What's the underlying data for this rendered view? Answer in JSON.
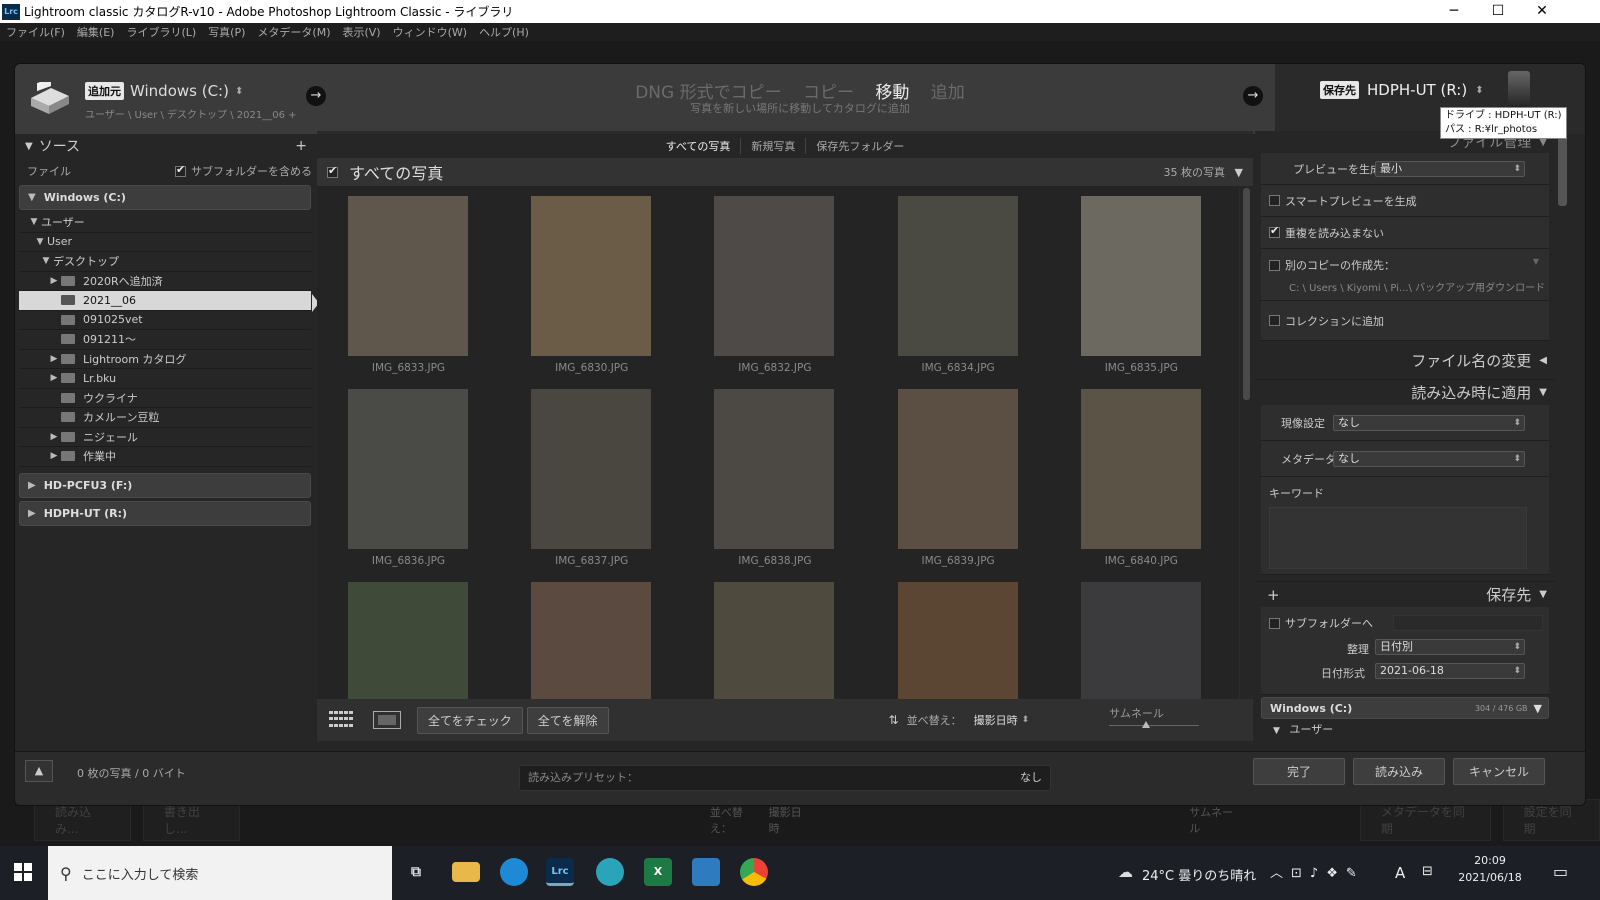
{
  "window": {
    "title": "Lightroom classic カタログR-v10 - Adobe Photoshop Lightroom Classic - ライブラリ",
    "app_icon": "Lrc",
    "minimize": "─",
    "maximize": "☐",
    "close": "✕"
  },
  "menu": [
    "ファイル(F)",
    "編集(E)",
    "ライブラリ(L)",
    "写真(P)",
    "メタデータ(M)",
    "表示(V)",
    "ウィンドウ(W)",
    "ヘルプ(H)"
  ],
  "background_bar": {
    "import": "読み込み...",
    "export": "書き出し...",
    "sort_label": "並べ替え：",
    "sort_value": "撮影日時",
    "thumb_label": "サムネール",
    "sync_meta": "メタデータを同期",
    "sync_settings": "設定を同期"
  },
  "import": {
    "source": {
      "badge": "追加元",
      "name": "Windows (C:)",
      "path": "ユーザー \\ User \\ デスクトップ \\ 2021__06 +"
    },
    "modes": [
      "DNG 形式でコピー",
      "コピー",
      "移動",
      "追加"
    ],
    "active_mode_index": 2,
    "mode_description": "写真を新しい場所に移動してカタログに追加",
    "destination": {
      "badge": "保存先",
      "name": "HDPH-UT (R:)"
    },
    "tooltip": {
      "line1": "ドライブ : HDPH-UT (R:)",
      "line2": "パス : R:¥lr_photos"
    },
    "left": {
      "header": "ソース",
      "add": "+",
      "file_label": "ファイル",
      "include_subfolders": "サブフォルダーを含める",
      "volumes": [
        {
          "name": "Windows (C:)",
          "expanded": true
        },
        {
          "name": "HD-PCFU3 (F:)",
          "expanded": false
        },
        {
          "name": "HDPH-UT (R:)",
          "expanded": false
        }
      ],
      "tree": [
        {
          "label": "ユーザー",
          "level": 1,
          "tri": "▼",
          "folder": false,
          "selected": false
        },
        {
          "label": "User",
          "level": 2,
          "tri": "▼",
          "folder": false,
          "selected": false
        },
        {
          "label": "デスクトップ",
          "level": 3,
          "tri": "▼",
          "folder": false,
          "selected": false
        },
        {
          "label": "2020Rへ追加済",
          "level": 4,
          "tri": "▶",
          "folder": true,
          "selected": false
        },
        {
          "label": "2021__06",
          "level": 4,
          "tri": "",
          "folder": true,
          "selected": true
        },
        {
          "label": "091025vet",
          "level": 4,
          "tri": "",
          "folder": true,
          "selected": false
        },
        {
          "label": "091211〜",
          "level": 4,
          "tri": "",
          "folder": true,
          "selected": false
        },
        {
          "label": "Lightroom カタログ",
          "level": 4,
          "tri": "▶",
          "folder": true,
          "selected": false
        },
        {
          "label": "Lr.bku",
          "level": 4,
          "tri": "▶",
          "folder": true,
          "selected": false
        },
        {
          "label": "ウクライナ",
          "level": 4,
          "tri": "",
          "folder": true,
          "selected": false
        },
        {
          "label": "カメルーン豆粒",
          "level": 4,
          "tri": "",
          "folder": true,
          "selected": false
        },
        {
          "label": "ニジェール",
          "level": 4,
          "tri": "▶",
          "folder": true,
          "selected": false
        },
        {
          "label": "作業中",
          "level": 4,
          "tri": "▶",
          "folder": true,
          "selected": false
        }
      ]
    },
    "center": {
      "tabs": [
        "すべての写真",
        "新規写真",
        "保存先フォルダー"
      ],
      "active_tab": 0,
      "grid_title": "すべての写真",
      "photo_count": "35 枚の写真",
      "photos": [
        {
          "name": "IMG_6833.JPG",
          "color": "#5f574b"
        },
        {
          "name": "IMG_6830.JPG",
          "color": "#6b5c47"
        },
        {
          "name": "IMG_6832.JPG",
          "color": "#4d4a47"
        },
        {
          "name": "IMG_6834.JPG",
          "color": "#4b4a42"
        },
        {
          "name": "IMG_6835.JPG",
          "color": "#6c6960"
        },
        {
          "name": "IMG_6836.JPG",
          "color": "#4a4a47"
        },
        {
          "name": "IMG_6837.JPG",
          "color": "#4a4640"
        },
        {
          "name": "IMG_6838.JPG",
          "color": "#4c4944"
        },
        {
          "name": "IMG_6839.JPG",
          "color": "#5a4f42"
        },
        {
          "name": "IMG_6840.JPG",
          "color": "#5b5446"
        },
        {
          "name": "",
          "color": "#3f4a38"
        },
        {
          "name": "",
          "color": "#5b4a40"
        },
        {
          "name": "",
          "color": "#4e4a3e"
        },
        {
          "name": "",
          "color": "#5a4632"
        },
        {
          "name": "",
          "color": "#3b3a3c"
        }
      ],
      "check_all": "全てをチェック",
      "uncheck_all": "全てを解除",
      "sort_label": "並べ替え：",
      "sort_value": "撮影日時",
      "thumb_label": "サムネール"
    },
    "right": {
      "file_handling": "ファイル管理",
      "build_previews_label": "プレビューを生成",
      "build_previews_value": "最小",
      "smart_previews": "スマートプレビューを生成",
      "no_duplicates": "重複を読み込まない",
      "second_copy": "別のコピーの作成先：",
      "second_copy_path": "C: \\ Users \\ Kiyomi \\ Pi...\\ バックアップ用ダウンロード",
      "add_to_collection": "コレクションに追加",
      "file_renaming": "ファイル名の変更",
      "apply_during_import": "読み込み時に適用",
      "develop_label": "現像設定",
      "develop_value": "なし",
      "metadata_label": "メタデータ",
      "metadata_value": "なし",
      "keywords_label": "キーワード",
      "destination": "保存先",
      "into_subfolder": "サブフォルダーへ",
      "organize_label": "整理",
      "organize_value": "日付別",
      "date_format_label": "日付形式",
      "date_format_value": "2021-06-18",
      "dest_volume": "Windows (C:)",
      "dest_volume_size": "304 / 476 GB",
      "dest_user": "ユーザー"
    },
    "bottom": {
      "status": "0 枚の写真 / 0 バイト",
      "preset_label": "読み込みプリセット：",
      "preset_value": "なし",
      "done": "完了",
      "import": "読み込み",
      "cancel": "キャンセル"
    }
  },
  "taskbar": {
    "search_placeholder": "ここに入力して検索",
    "weather": "24°C  曇りのち晴れ",
    "ime": "A",
    "time": "20:09",
    "date": "2021/06/18"
  }
}
